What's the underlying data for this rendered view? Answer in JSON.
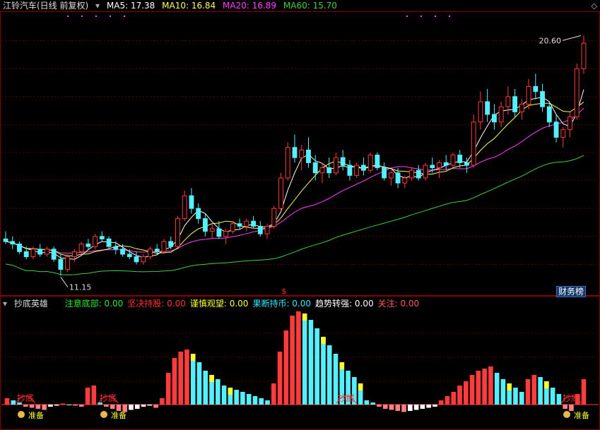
{
  "header": {
    "title": "江铃汽车(日线 前复权)",
    "ma5": "MA5: 17.38",
    "ma10": "MA10: 16.84",
    "ma20": "MA20: 16.89",
    "ma60": "MA60: 15.70",
    "corner_icon": "diamond-icon"
  },
  "price_labels": {
    "high": "20.60",
    "low": "11.15"
  },
  "badge": "财务榜",
  "sub_panel": {
    "name": "抄底英雄",
    "items": [
      {
        "label": "注意底部:",
        "value": "0.00",
        "color": "#2ee82e"
      },
      {
        "label": "坚决持股:",
        "value": "0.00",
        "color": "#ff3030"
      },
      {
        "label": "谨慎观望:",
        "value": "0.00",
        "color": "#ffff30"
      },
      {
        "label": "果断持币:",
        "value": "0.00",
        "color": "#33e8ff"
      },
      {
        "label": "趋势转强:",
        "value": "0.00",
        "color": "#ffffff"
      },
      {
        "label": "关注:",
        "value": "0.00",
        "color": "#ff5a5a"
      }
    ],
    "signal_label": "抄底",
    "coin_label": "准备"
  },
  "colors": {
    "up": "#ff3b3b",
    "down": "#54f0ff",
    "ma5": "#ffffff",
    "ma10": "#ffff55",
    "ma20": "#ff40ff",
    "ma60": "#40d040"
  },
  "chart_data": [
    {
      "type": "candlestick",
      "ylim": [
        10.5,
        21.5
      ],
      "ylabel": "",
      "annotations": [
        {
          "label": "20.60",
          "y": 20.6
        },
        {
          "label": "11.15",
          "y": 11.15
        }
      ],
      "candles": [
        [
          12.6,
          12.9,
          12.4,
          12.5
        ],
        [
          12.5,
          12.7,
          12.2,
          12.4
        ],
        [
          12.4,
          12.5,
          12.0,
          12.1
        ],
        [
          12.1,
          12.3,
          11.8,
          11.9
        ],
        [
          11.9,
          12.3,
          11.8,
          12.2
        ],
        [
          12.2,
          12.4,
          11.9,
          12.0
        ],
        [
          12.0,
          12.3,
          11.9,
          12.2
        ],
        [
          12.2,
          12.3,
          11.7,
          11.8
        ],
        [
          11.8,
          12.0,
          11.15,
          11.4
        ],
        [
          11.4,
          12.0,
          11.3,
          11.9
        ],
        [
          11.9,
          12.2,
          11.7,
          12.1
        ],
        [
          12.1,
          12.5,
          12.0,
          12.4
        ],
        [
          12.4,
          12.6,
          12.2,
          12.3
        ],
        [
          12.3,
          12.8,
          12.2,
          12.7
        ],
        [
          12.7,
          12.9,
          12.5,
          12.6
        ],
        [
          12.6,
          12.7,
          12.2,
          12.3
        ],
        [
          12.3,
          12.5,
          12.0,
          12.2
        ],
        [
          12.2,
          12.4,
          11.9,
          12.0
        ],
        [
          12.0,
          12.2,
          11.8,
          11.9
        ],
        [
          11.9,
          12.1,
          11.6,
          11.7
        ],
        [
          11.7,
          12.0,
          11.6,
          11.9
        ],
        [
          11.9,
          12.3,
          11.8,
          12.2
        ],
        [
          12.2,
          12.4,
          12.0,
          12.1
        ],
        [
          12.1,
          12.6,
          12.0,
          12.5
        ],
        [
          12.5,
          12.7,
          12.2,
          12.3
        ],
        [
          12.3,
          13.5,
          12.3,
          13.4
        ],
        [
          13.4,
          14.5,
          13.3,
          14.3
        ],
        [
          14.3,
          14.6,
          13.6,
          13.8
        ],
        [
          13.8,
          14.0,
          13.2,
          13.4
        ],
        [
          13.4,
          13.6,
          12.7,
          12.9
        ],
        [
          12.9,
          13.2,
          12.6,
          13.0
        ],
        [
          13.0,
          13.3,
          12.6,
          12.7
        ],
        [
          12.7,
          13.0,
          12.4,
          12.9
        ],
        [
          12.9,
          13.3,
          12.8,
          13.2
        ],
        [
          13.2,
          13.4,
          13.0,
          13.1
        ],
        [
          13.1,
          13.4,
          12.9,
          13.3
        ],
        [
          13.3,
          13.5,
          13.0,
          13.1
        ],
        [
          13.1,
          13.3,
          12.7,
          12.8
        ],
        [
          12.8,
          13.2,
          12.6,
          13.1
        ],
        [
          13.1,
          13.9,
          13.0,
          13.8
        ],
        [
          13.8,
          15.2,
          13.7,
          15.0
        ],
        [
          15.0,
          16.4,
          14.9,
          16.2
        ],
        [
          16.2,
          16.7,
          15.6,
          15.8
        ],
        [
          15.8,
          16.3,
          15.3,
          16.1
        ],
        [
          16.1,
          16.6,
          15.4,
          15.6
        ],
        [
          15.6,
          15.9,
          14.9,
          15.2
        ],
        [
          15.2,
          15.6,
          14.8,
          15.4
        ],
        [
          15.4,
          15.8,
          15.0,
          15.2
        ],
        [
          15.2,
          16.0,
          15.1,
          15.8
        ],
        [
          15.8,
          16.1,
          15.3,
          15.5
        ],
        [
          15.5,
          15.7,
          14.9,
          15.1
        ],
        [
          15.1,
          15.6,
          15.0,
          15.5
        ],
        [
          15.5,
          15.8,
          15.1,
          15.3
        ],
        [
          15.3,
          16.0,
          15.2,
          15.9
        ],
        [
          15.9,
          16.0,
          15.3,
          15.4
        ],
        [
          15.4,
          15.6,
          14.9,
          15.0
        ],
        [
          15.0,
          15.3,
          14.7,
          15.2
        ],
        [
          15.2,
          15.4,
          14.6,
          14.8
        ],
        [
          14.8,
          15.1,
          14.6,
          15.0
        ],
        [
          15.0,
          15.4,
          14.9,
          15.3
        ],
        [
          15.3,
          15.5,
          14.9,
          15.0
        ],
        [
          15.0,
          15.6,
          14.9,
          15.5
        ],
        [
          15.5,
          15.8,
          15.2,
          15.4
        ],
        [
          15.4,
          15.7,
          15.0,
          15.6
        ],
        [
          15.6,
          15.9,
          15.3,
          15.5
        ],
        [
          15.5,
          16.0,
          15.4,
          15.9
        ],
        [
          15.9,
          16.1,
          15.4,
          15.6
        ],
        [
          15.6,
          15.8,
          15.2,
          15.5
        ],
        [
          15.5,
          17.5,
          15.4,
          17.2
        ],
        [
          17.2,
          18.4,
          16.9,
          18.0
        ],
        [
          18.0,
          18.5,
          17.2,
          17.5
        ],
        [
          17.5,
          17.9,
          16.9,
          17.2
        ],
        [
          17.2,
          18.0,
          17.0,
          17.8
        ],
        [
          17.8,
          18.6,
          17.5,
          18.2
        ],
        [
          18.2,
          18.5,
          17.4,
          17.6
        ],
        [
          17.6,
          18.1,
          17.3,
          17.9
        ],
        [
          17.9,
          18.9,
          17.7,
          18.6
        ],
        [
          18.6,
          19.1,
          18.1,
          18.4
        ],
        [
          18.4,
          18.7,
          17.6,
          17.8
        ],
        [
          17.8,
          18.0,
          17.0,
          17.2
        ],
        [
          17.2,
          17.5,
          16.4,
          16.6
        ],
        [
          16.6,
          17.0,
          16.2,
          16.9
        ],
        [
          16.9,
          17.6,
          16.6,
          17.4
        ],
        [
          17.4,
          19.5,
          17.3,
          19.3
        ],
        [
          19.3,
          20.6,
          19.1,
          20.3
        ]
      ],
      "ma_lines": [
        "MA5",
        "MA10",
        "MA20",
        "MA60"
      ]
    },
    {
      "type": "bar",
      "title": "抄底英雄",
      "series": [
        {
          "name": "坚决持股",
          "color": "#ff3030"
        },
        {
          "name": "谨慎观望",
          "color": "#ffff30"
        },
        {
          "name": "果断持币",
          "color": "#33e8ff"
        },
        {
          "name": "趋势转强",
          "color": "#ffffff"
        },
        {
          "name": "关注",
          "color": "#ff5a5a"
        }
      ],
      "values": [
        0.3,
        0.2,
        0.1,
        -0.1,
        -0.15,
        -0.2,
        -0.25,
        -0.1,
        -0.05,
        0.05,
        0,
        -0.05,
        -0.1,
        0.8,
        0.9,
        0.1,
        -0.1,
        -0.2,
        -0.3,
        -0.35,
        -0.25,
        -0.2,
        -0.1,
        -0.05,
        -0.15,
        0.3,
        1.5,
        2.2,
        2.5,
        2.6,
        2.4,
        2.0,
        1.6,
        1.4,
        1.2,
        0.9,
        0.8,
        0.7,
        0.6,
        0.5,
        0.4,
        0.3,
        0.2,
        1.0,
        2.5,
        3.5,
        4.2,
        4.4,
        4.3,
        4.0,
        3.6,
        3.2,
        2.8,
        2.4,
        2.0,
        1.6,
        1.3,
        1.0,
        0.2,
        0.1,
        -0.1,
        -0.2,
        -0.25,
        -0.3,
        -0.35,
        -0.3,
        -0.25,
        -0.2,
        -0.15,
        -0.1,
        0.2,
        0.4,
        0.6,
        0.9,
        1.1,
        1.4,
        1.6,
        1.7,
        1.8,
        1.5,
        1.2,
        1.0,
        0.8,
        0.6,
        1.2,
        1.4,
        1.3,
        1.1,
        0.8,
        0.5,
        -0.2,
        -0.3,
        0.5,
        1.2
      ]
    }
  ]
}
